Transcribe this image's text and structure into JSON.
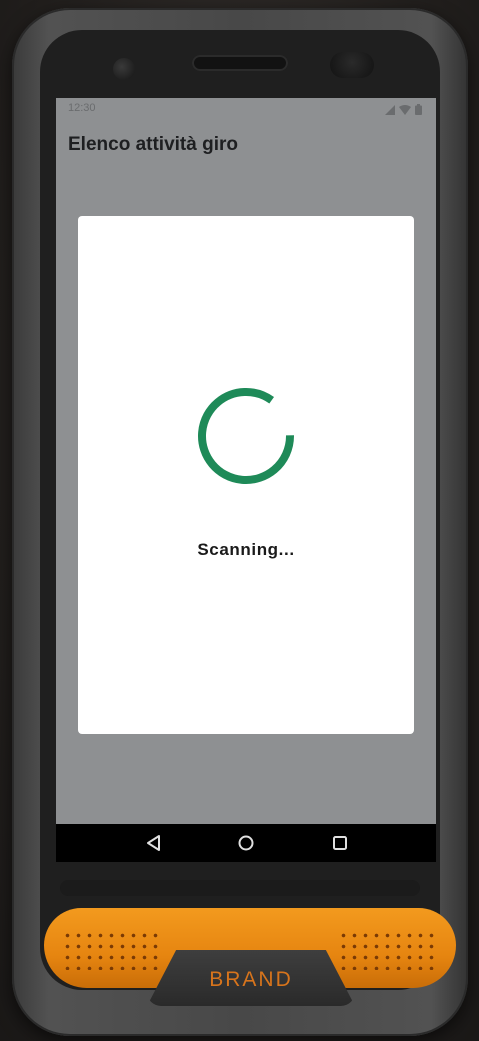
{
  "status_bar": {
    "time": "12:30",
    "icons": [
      "signal-icon",
      "wifi-icon",
      "battery-icon"
    ]
  },
  "app": {
    "title": "Elenco attività giro"
  },
  "dialog": {
    "label": "Scanning...",
    "spinner_color": "#1e8a58"
  },
  "nav_bar": {
    "buttons": [
      "back-icon",
      "home-icon",
      "recents-icon"
    ]
  },
  "device": {
    "brand": "BRAND",
    "bumper_color": "#f39a1e"
  }
}
